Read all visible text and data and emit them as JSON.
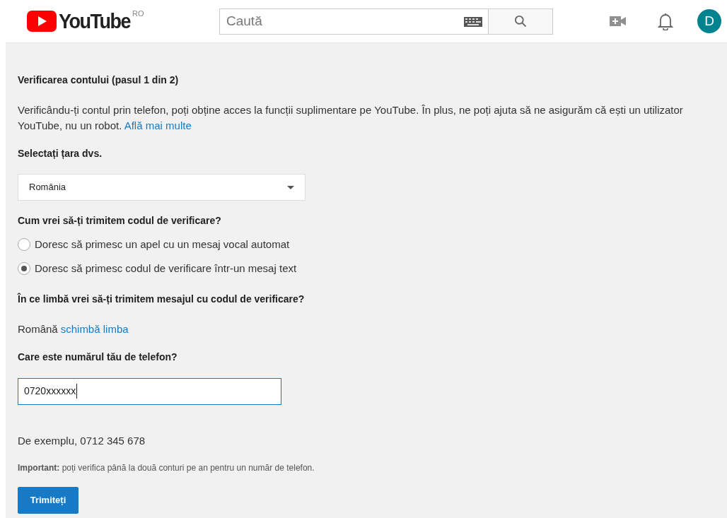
{
  "header": {
    "logo_text": "YouTube",
    "region": "RO",
    "search": {
      "placeholder": "Caută"
    },
    "avatar": "D"
  },
  "title": "Verificarea contului (pasul 1 din 2)",
  "intro": {
    "text": "Verificându-ți contul prin telefon, poți obține acces la funcții suplimentare pe YouTube. În plus, ne poți ajuta să ne asigurăm că ești un utilizator YouTube, nu un robot.",
    "link": "Află mai multe"
  },
  "country": {
    "label": "Selectați țara dvs.",
    "value": "România"
  },
  "method": {
    "label": "Cum vrei să-ți trimitem codul de verificare?",
    "options": [
      {
        "label": "Doresc să primesc un apel cu un mesaj vocal automat",
        "selected": false
      },
      {
        "label": "Doresc să primesc codul de verificare într-un mesaj text",
        "selected": true
      }
    ]
  },
  "language": {
    "label": "În ce limbă vrei să-ți trimitem mesajul cu codul de verificare?",
    "value": "Română",
    "link": "schimbă limba"
  },
  "phone": {
    "label": "Care este numărul tău de telefon?",
    "value": "0720xxxxxx",
    "example": "De exemplu, 0712 345 678"
  },
  "note": "**Important:** poți verifica până la două conturi pe an pentru un număr de telefon.",
  "submit": "Trimiteți"
}
